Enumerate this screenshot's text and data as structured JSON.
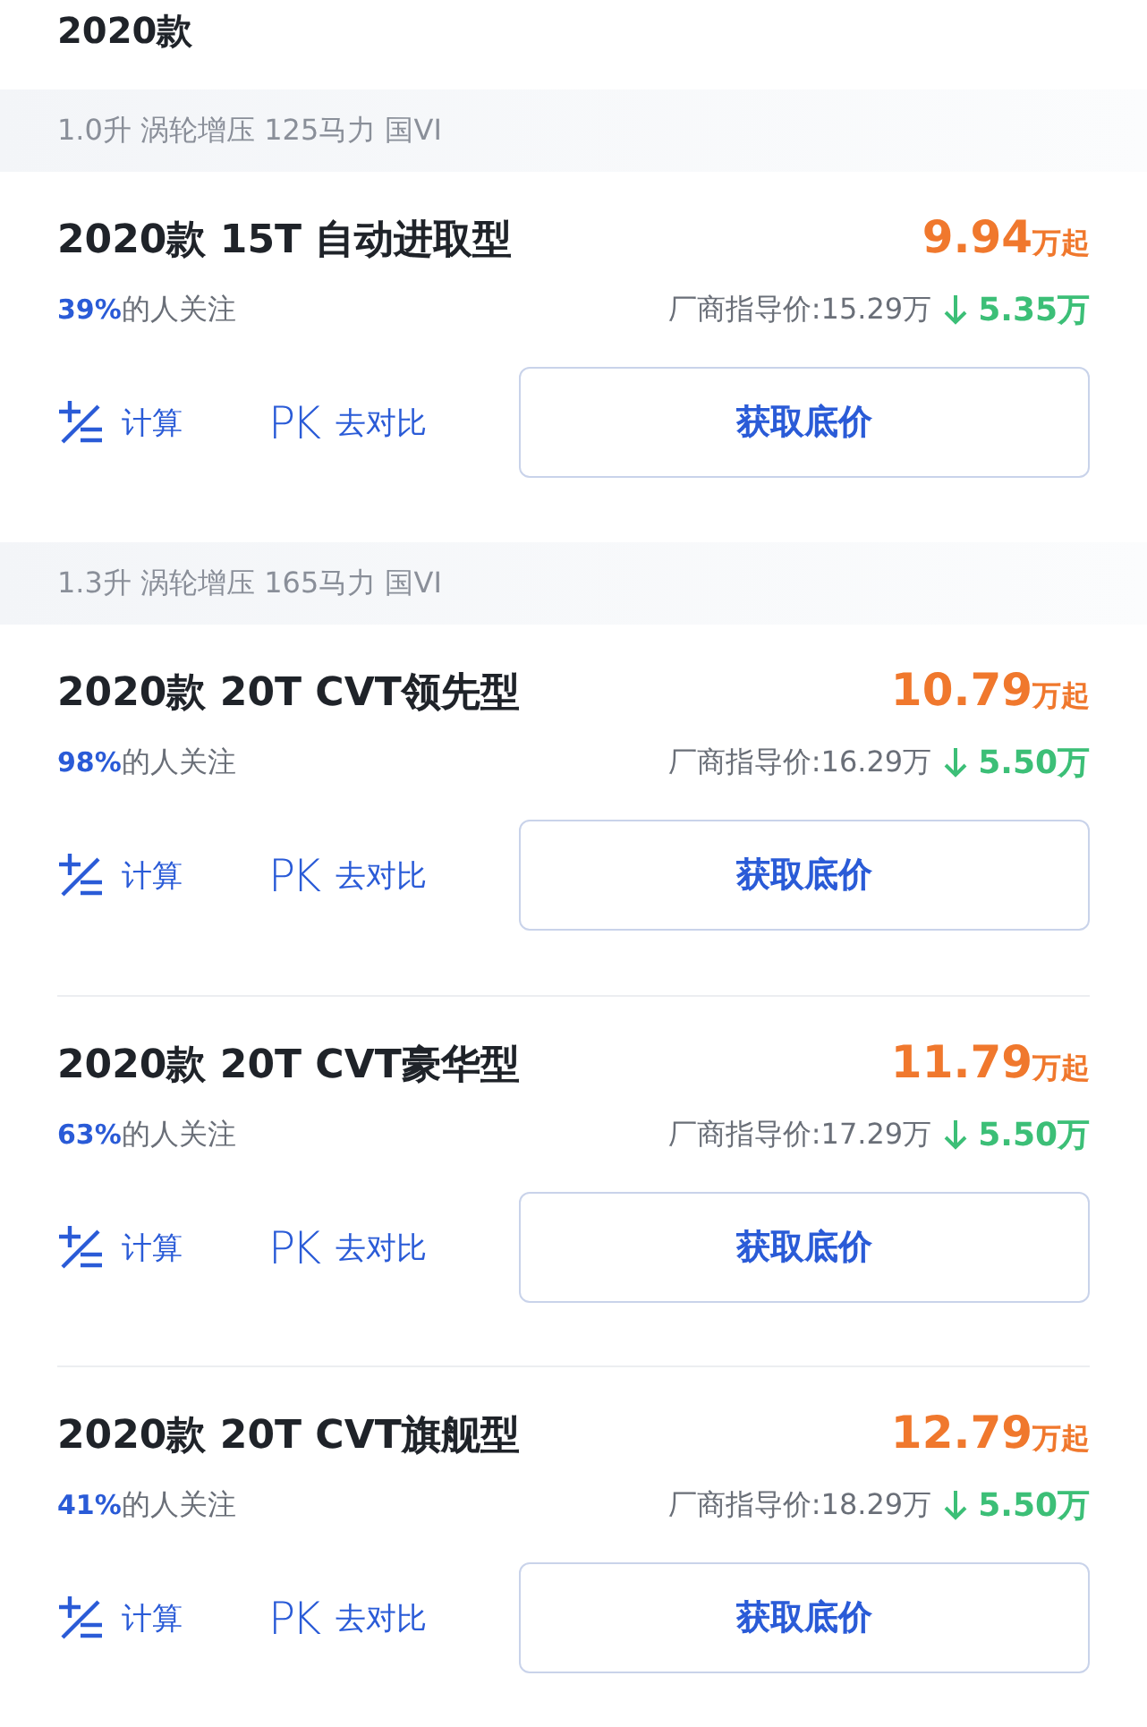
{
  "year_heading": "2020款",
  "groups": [
    {
      "spec": "1.0升 涡轮增压 125马力 国VI",
      "trims": [
        {
          "name": "2020款 15T 自动进取型",
          "price": "9.94",
          "price_unit": "万起",
          "share": "39%",
          "share_label": "的人关注",
          "msrp": "厂商指导价:15.29万",
          "discount": "5.35万",
          "calc": "计算",
          "pk": "PK",
          "compare": "去对比",
          "button": "获取底价"
        }
      ]
    },
    {
      "spec": "1.3升 涡轮增压 165马力 国VI",
      "trims": [
        {
          "name": "2020款 20T CVT领先型",
          "price": "10.79",
          "price_unit": "万起",
          "share": "98%",
          "share_label": "的人关注",
          "msrp": "厂商指导价:16.29万",
          "discount": "5.50万",
          "calc": "计算",
          "pk": "PK",
          "compare": "去对比",
          "button": "获取底价"
        },
        {
          "name": "2020款 20T CVT豪华型",
          "price": "11.79",
          "price_unit": "万起",
          "share": "63%",
          "share_label": "的人关注",
          "msrp": "厂商指导价:17.29万",
          "discount": "5.50万",
          "calc": "计算",
          "pk": "PK",
          "compare": "去对比",
          "button": "获取底价"
        },
        {
          "name": "2020款 20T CVT旗舰型",
          "price": "12.79",
          "price_unit": "万起",
          "share": "41%",
          "share_label": "的人关注",
          "msrp": "厂商指导价:18.29万",
          "discount": "5.50万",
          "calc": "计算",
          "pk": "PK",
          "compare": "去对比",
          "button": "获取底价"
        }
      ]
    }
  ]
}
